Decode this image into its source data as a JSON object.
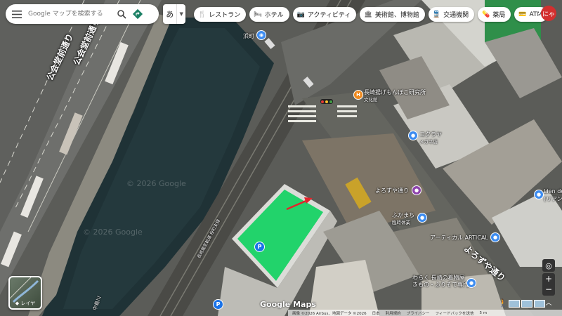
{
  "search": {
    "placeholder": "Google マップを検索する"
  },
  "ime": {
    "label": "あ"
  },
  "chips": [
    {
      "icon": "restaurant-icon",
      "glyph": "🍴",
      "label": "レストラン"
    },
    {
      "icon": "hotel-icon",
      "glyph": "🛏",
      "label": "ホテル"
    },
    {
      "icon": "camera-icon",
      "glyph": "📷",
      "label": "アクティビティ"
    },
    {
      "icon": "museum-icon",
      "glyph": "🏛",
      "label": "美術館、博物館"
    },
    {
      "icon": "transit-icon",
      "glyph": "🚆",
      "label": "交通機関"
    },
    {
      "icon": "pharmacy-icon",
      "glyph": "💊",
      "label": "薬局"
    },
    {
      "icon": "atm-icon",
      "glyph": "💳",
      "label": "ATM"
    }
  ],
  "user": {
    "avatar_text": "にゃ"
  },
  "layers": {
    "label": "レイヤ"
  },
  "brand": "Google Maps",
  "footer": {
    "imagery": "画像 ©2026 Airbus、地図データ ©2026",
    "japan": "日本",
    "terms": "利用規約",
    "privacy": "プライバシー",
    "feedback": "フィードバックを送信",
    "scale": "5 m"
  },
  "map_labels": {
    "road_left": "公会堂前通り",
    "road_bottom": "よろずや通り",
    "station_top": "浜町",
    "tram_line": "長崎電気軌道 桜町支線",
    "poi_lab": "長崎揚げもんぼこ研究所",
    "poi_lab_sub": "文化館",
    "poi_kogura": "コクラヤ",
    "poi_kogura_sub": "メガネ店",
    "poi_yorozuya": "よろずや通り",
    "poi_fukamachi": "ふかまち",
    "poi_fukamachi_sub": "臨時休業",
    "poi_artical": "アーティカル ARTICAL",
    "poi_kimono": "わらく 長崎の着物屋",
    "poi_kimono_sub": "きもの・ふりそで専門店",
    "poi_lien": "Lien de",
    "poi_lien_sub": "(リアン",
    "river": "中島川",
    "watermark": "© 2026 Google"
  }
}
